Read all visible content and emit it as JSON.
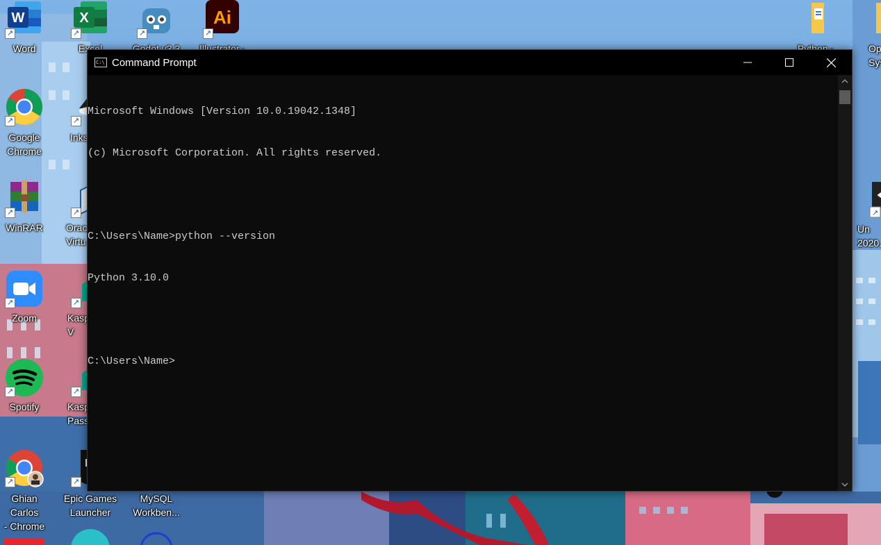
{
  "desktop": {
    "icons_left": [
      {
        "label": "Word",
        "icon": "word-icon",
        "color": "#2b579a"
      },
      {
        "label": "Google\nChrome",
        "icon": "chrome-icon",
        "color": "#4285f4"
      },
      {
        "label": "WinRAR",
        "icon": "winrar-icon",
        "color": "#8e2a8c"
      },
      {
        "label": "Zoom",
        "icon": "zoom-icon",
        "color": "#2d8cff"
      },
      {
        "label": "Spotify",
        "icon": "spotify-icon",
        "color": "#1db954"
      },
      {
        "label": "Ghian Carlos\n- Chrome",
        "icon": "chrome-profile-icon",
        "color": "#4285f4"
      }
    ],
    "icons_second": [
      {
        "label": "Excel",
        "icon": "excel-icon",
        "color": "#217346"
      },
      {
        "label": "Inks",
        "icon": "inkscape-icon",
        "color": "#222222"
      },
      {
        "label": "Orac\nVirtu",
        "icon": "virtualbox-icon",
        "color": "#1b5fa3"
      },
      {
        "label": "Kasp\nV",
        "icon": "kaspersky-icon",
        "color": "#00a88e"
      },
      {
        "label": "Kasp\nPass",
        "icon": "kaspersky-password-icon",
        "color": "#00a88e"
      },
      {
        "label": "Epic Games\nLauncher",
        "icon": "epic-games-icon",
        "color": "#111111"
      }
    ],
    "top_row": [
      {
        "label": "Godot v3.3",
        "icon": "godot-icon",
        "color": "#478cbf"
      },
      {
        "label": "Illustrator -",
        "icon": "illustrator-icon",
        "color": "#330000"
      }
    ],
    "mysql": {
      "label": "MySQL\nWorkben...",
      "icon": "mysql-workbench-icon"
    },
    "icons_right": [
      {
        "label": "Python -",
        "icon": "folder-icon"
      },
      {
        "label": "Oper\nSyste",
        "icon": "folder-icon"
      },
      {
        "label": "Un\n2020.",
        "icon": "unity-icon"
      }
    ],
    "word_glyph": "W",
    "excel_glyph": "X",
    "ai_glyph": "Ai"
  },
  "window": {
    "title": "Command Prompt",
    "icon_glyph": "C:\\",
    "lines": [
      "Microsoft Windows [Version 10.0.19042.1348]",
      "(c) Microsoft Corporation. All rights reserved.",
      "",
      "C:\\Users\\Name>python --version",
      "Python 3.10.0",
      "",
      "C:\\Users\\Name>"
    ]
  },
  "colors": {
    "console_bg": "#0c0c0c",
    "console_text": "#cccccc",
    "titlebar_bg": "#000000"
  }
}
